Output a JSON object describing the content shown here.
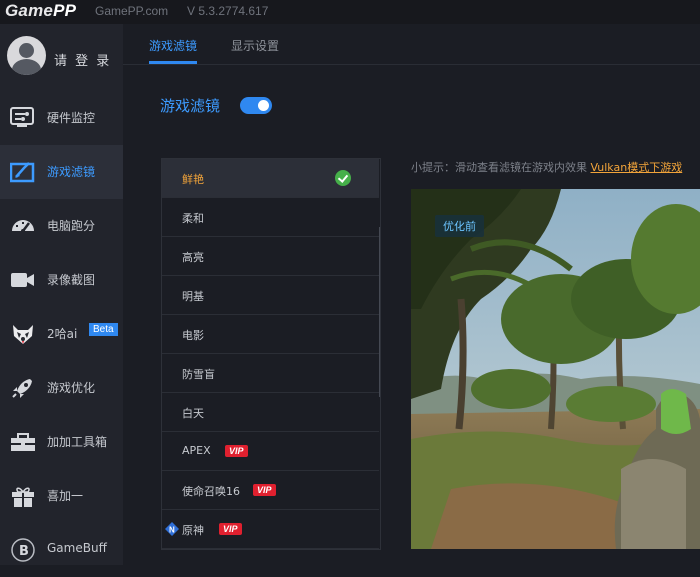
{
  "titlebar": {
    "logo_game": "Game",
    "logo_pp": "PP",
    "site": "GamePP.com",
    "version": "V 5.3.2774.617"
  },
  "sidebar": {
    "login_label": "请 登 录",
    "items": [
      {
        "label": "硬件监控",
        "icon": "hardware-monitor-icon"
      },
      {
        "label": "游戏滤镜",
        "icon": "game-filter-icon",
        "active": true
      },
      {
        "label": "电脑跑分",
        "icon": "benchmark-gauge-icon"
      },
      {
        "label": "录像截图",
        "icon": "video-camera-icon"
      },
      {
        "label": "2哈ai",
        "icon": "husky-icon",
        "badge": "Beta"
      },
      {
        "label": "游戏优化",
        "icon": "rocket-icon"
      },
      {
        "label": "加加工具箱",
        "icon": "toolbox-icon"
      },
      {
        "label": "喜加一",
        "icon": "gift-icon"
      },
      {
        "label": "GameBuff",
        "icon": "gamebuff-logo-icon"
      }
    ]
  },
  "tabs": [
    {
      "label": "游戏滤镜",
      "active": true
    },
    {
      "label": "显示设置",
      "active": false
    }
  ],
  "feature": {
    "title": "游戏滤镜",
    "enabled": true
  },
  "filters": [
    {
      "label": "鲜艳",
      "selected": true
    },
    {
      "label": "柔和"
    },
    {
      "label": "高亮"
    },
    {
      "label": "明基"
    },
    {
      "label": "电影"
    },
    {
      "label": "防雪盲"
    },
    {
      "label": "白天"
    },
    {
      "label": "APEX",
      "vip": "VIP"
    },
    {
      "label": "使命召唤16",
      "vip": "VIP"
    },
    {
      "label": "原神",
      "vip": "VIP",
      "prefix_icon": "new-n-icon"
    }
  ],
  "hint": {
    "prefix": "小提示：滑动查看滤镜在游戏内效果 ",
    "link": "Vulkan模式下游戏"
  },
  "preview": {
    "before_label": "优化前"
  },
  "colors": {
    "accent": "#2f88f0",
    "selected_text": "#f2a43a",
    "vip": "#e0202f",
    "check": "#46b04a"
  }
}
